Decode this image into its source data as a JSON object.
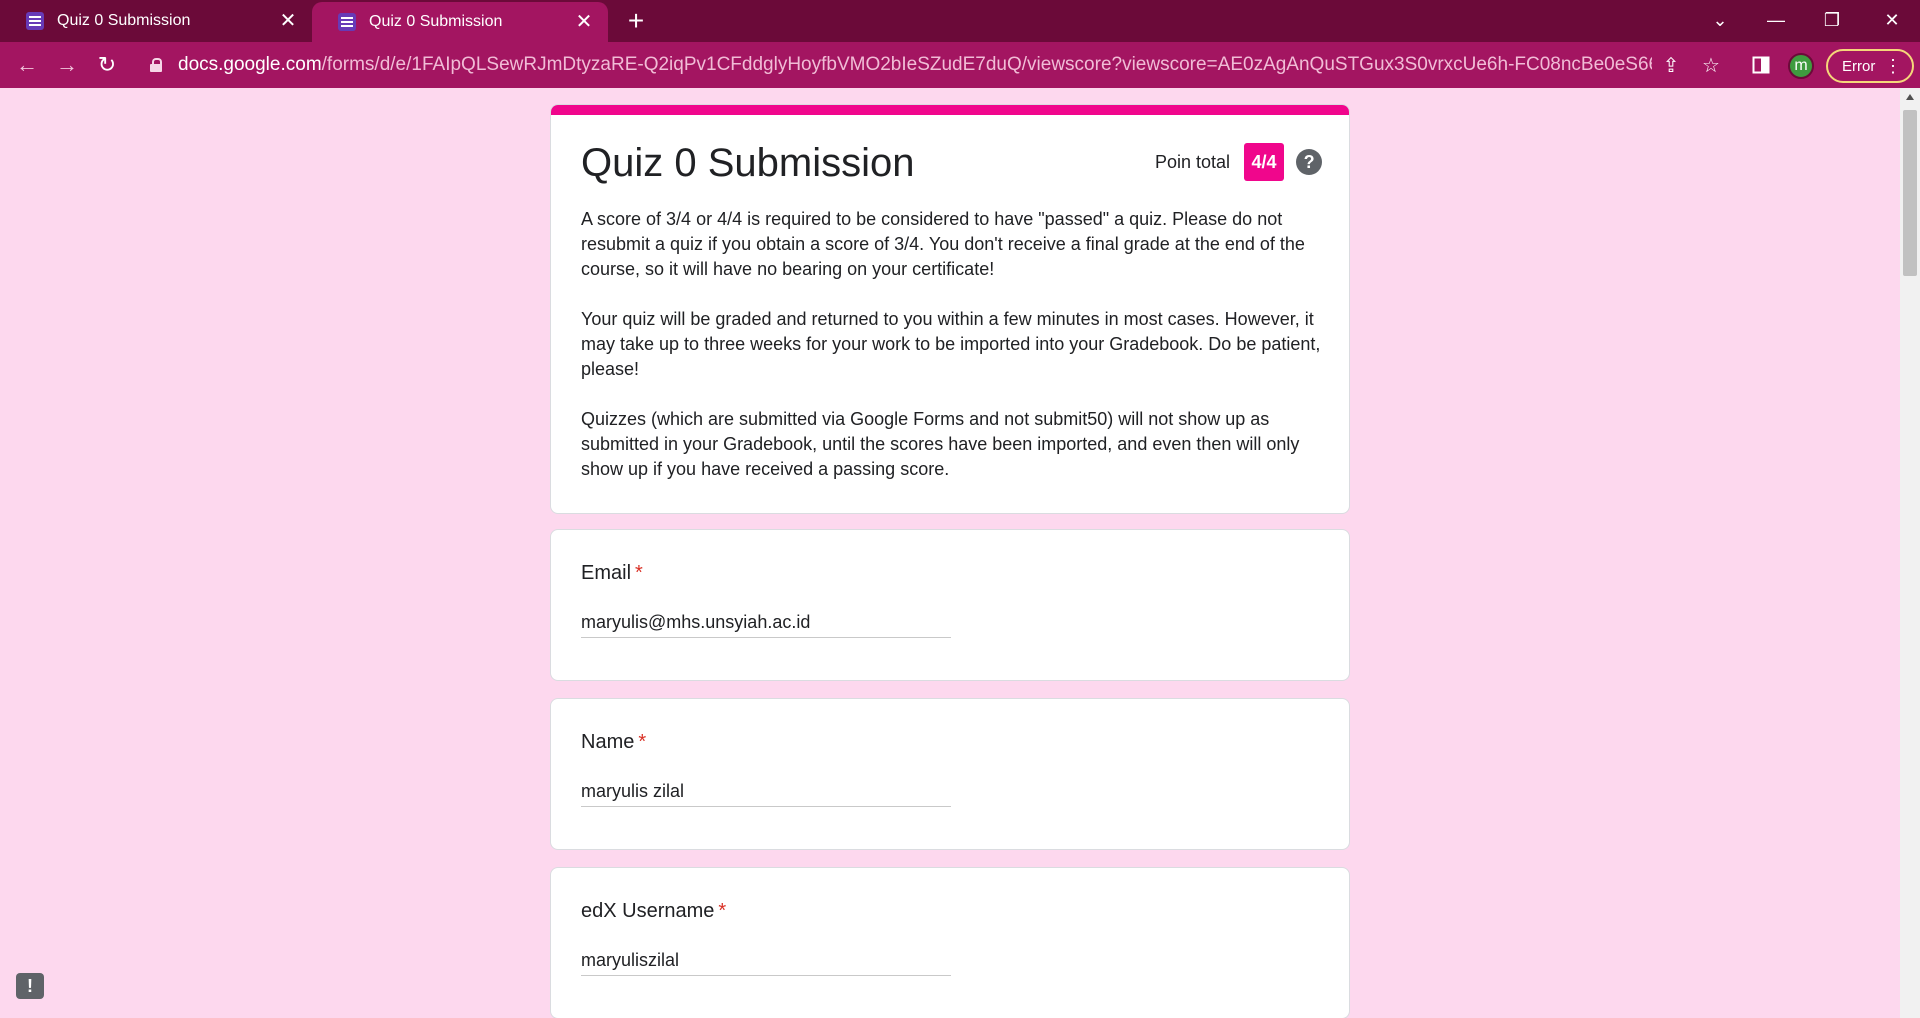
{
  "browser": {
    "tabs": [
      {
        "title": "Quiz 0 Submission",
        "active": false
      },
      {
        "title": "Quiz 0 Submission",
        "active": true
      }
    ],
    "url_host": "docs.google.com",
    "url_path": "/forms/d/e/1FAIpQLSewRJmDtyzaRE-Q2iqPv1CFddglyHoyfbVMO2bIeSZudE7duQ/viewscore?viewscore=AE0zAgAnQuSTGux3S0vrxcUe6h-FC08ncBe0eS66kmkxdk1cLPmATp...",
    "profile_initial": "m",
    "error_label": "Error",
    "accent_color": "#a31561",
    "tabbar_color": "#6b0a39"
  },
  "form": {
    "title": "Quiz 0 Submission",
    "points_label": "Poin total",
    "score": "4/4",
    "help_glyph": "?",
    "description": [
      "A score of 3/4 or 4/4 is required to be considered to have \"passed\" a quiz. Please do not resubmit a quiz if you obtain a score of 3/4. You don't receive a final grade at the end of the course, so it will have no bearing on your certificate!",
      "Your quiz will be graded and returned to you within a few minutes in most cases. However, it may take up to three weeks for your work to be imported into your Gradebook. Do be patient, please!",
      "Quizzes (which are submitted via Google Forms and not submit50) will not show up as submitted in your Gradebook, until the scores have been imported, and even then will only show up if you have received a passing score."
    ],
    "theme_color": "#f0068c",
    "background_color": "#fdd8ee",
    "questions": [
      {
        "title": "Email",
        "required_mark": "*",
        "answer": "maryulis@mhs.unsyiah.ac.id"
      },
      {
        "title": "Name",
        "required_mark": "*",
        "answer": "maryulis zilal"
      },
      {
        "title": "edX Username",
        "required_mark": "*",
        "answer": "maryuliszilal"
      }
    ]
  },
  "feedback_glyph": "!"
}
